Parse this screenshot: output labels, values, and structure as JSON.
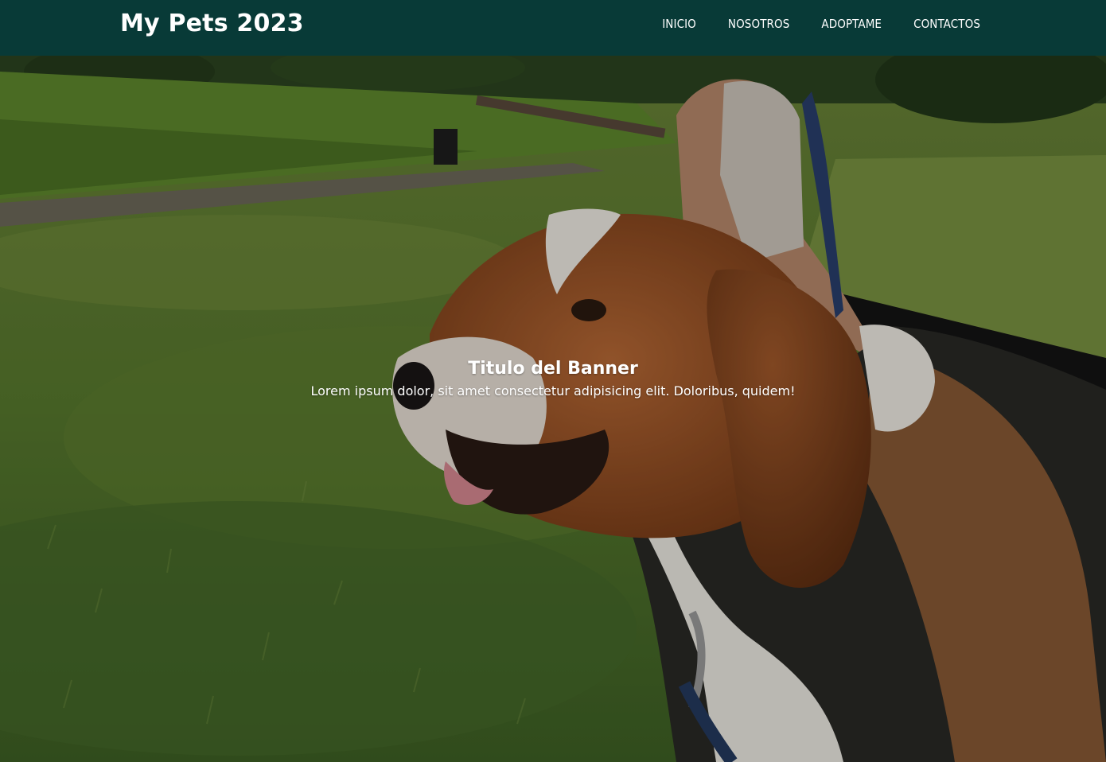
{
  "header": {
    "brand": "My Pets 2023",
    "nav": [
      "INICIO",
      "NOSOTROS",
      "ADOPTAME",
      "CONTACTOS"
    ]
  },
  "banner": {
    "title": "Titulo del Banner",
    "subtitle": "Lorem ipsum dolor, sit amet consectetur adipisicing elit. Doloribus, quidem!"
  },
  "colors": {
    "header_bg": "#083a37",
    "text": "#ffffff"
  },
  "icons": {
    "banner_image": "beagle-dog-photo"
  }
}
